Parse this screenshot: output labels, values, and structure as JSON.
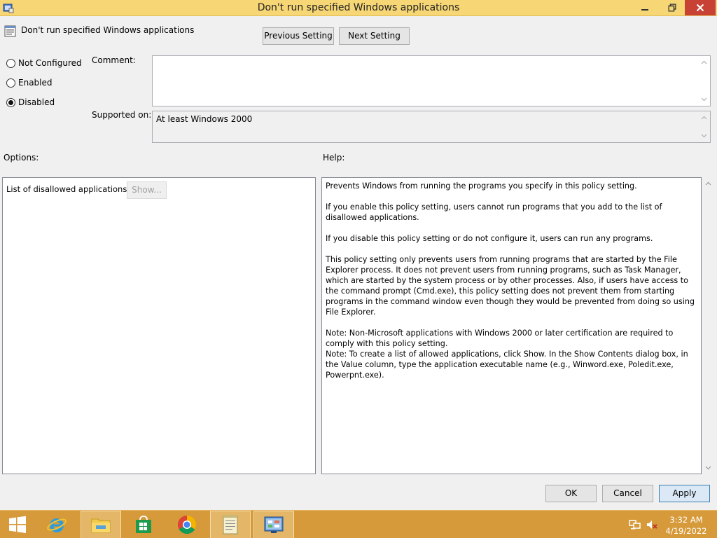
{
  "window": {
    "title": "Don't run specified Windows applications"
  },
  "header": {
    "policy_name": "Don't run specified Windows applications",
    "prev_label": "Previous Setting",
    "next_label": "Next Setting"
  },
  "state": {
    "options": [
      "Not Configured",
      "Enabled",
      "Disabled"
    ],
    "selected": "Disabled"
  },
  "comment": {
    "label": "Comment:",
    "value": ""
  },
  "supported": {
    "label": "Supported on:",
    "value": "At least Windows 2000"
  },
  "options_pane": {
    "label": "Options:",
    "list_label": "List of disallowed applications",
    "show_label": "Show..."
  },
  "help_pane": {
    "label": "Help:",
    "paragraphs": [
      "Prevents Windows from running the programs you specify in this policy setting.",
      "If you enable this policy setting, users cannot run programs that you add to the list of disallowed applications.",
      "If you disable this policy setting or do not configure it, users can run any programs.",
      "This policy setting only prevents users from running programs that are started by the File Explorer process. It does not prevent users from running programs, such as Task Manager, which are started by the system process or by other processes.  Also, if users have access to the command prompt (Cmd.exe), this policy setting does not prevent them from starting programs in the command window even though they would be prevented from doing so using File Explorer.",
      "Note: Non-Microsoft applications with Windows 2000 or later certification are required to comply with this policy setting.",
      "Note: To create a list of allowed applications, click Show.  In the Show Contents dialog box, in the Value column, type the application executable name (e.g., Winword.exe, Poledit.exe, Powerpnt.exe)."
    ]
  },
  "footer": {
    "ok_label": "OK",
    "cancel_label": "Cancel",
    "apply_label": "Apply"
  },
  "taskbar": {
    "items": [
      "start-icon",
      "internet-explorer-icon",
      "file-explorer-icon",
      "store-icon",
      "chrome-icon",
      "notepad-icon",
      "control-panel-icon"
    ],
    "time": "3:32 AM",
    "date": "4/19/2022"
  },
  "colors": {
    "titlebar": "#f6d675",
    "close_button": "#c74234",
    "taskbar": "#d69a3a"
  }
}
